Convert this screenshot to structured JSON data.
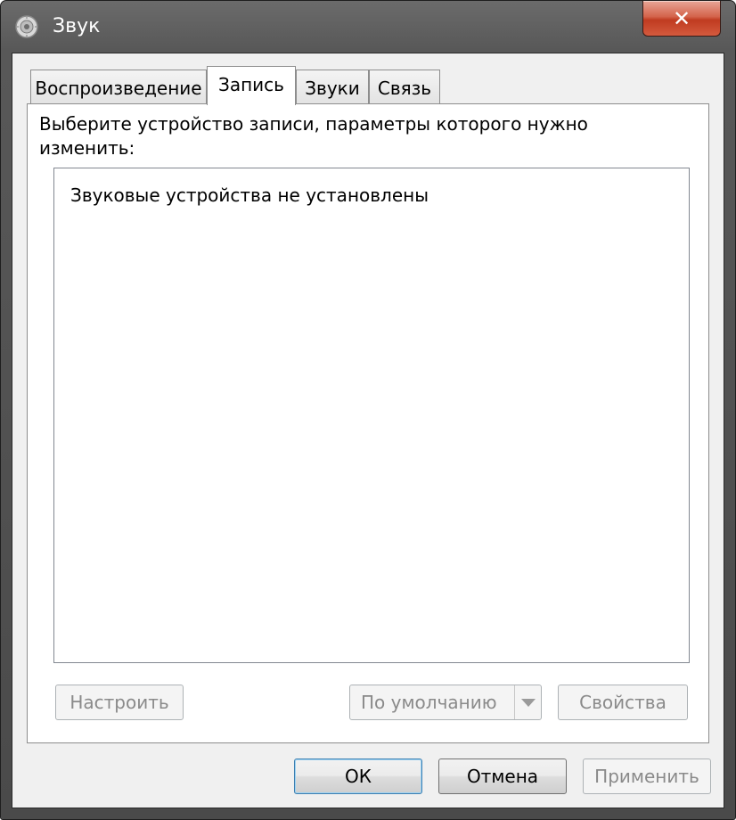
{
  "window": {
    "title": "Звук",
    "close_label": "✕"
  },
  "tabs": [
    {
      "label": "Воспроизведение",
      "active": false
    },
    {
      "label": "Запись",
      "active": true
    },
    {
      "label": "Звуки",
      "active": false
    },
    {
      "label": "Связь",
      "active": false
    }
  ],
  "recording": {
    "instructions": "Выберите устройство записи, параметры которого нужно изменить:",
    "empty_message": "Звуковые устройства не установлены",
    "configure_label": "Настроить",
    "default_label": "По умолчанию",
    "properties_label": "Свойства"
  },
  "footer": {
    "ok_label": "ОК",
    "cancel_label": "Отмена",
    "apply_label": "Применить"
  },
  "colors": {
    "frame": "#585858",
    "close_button": "#c03b20",
    "dialog_background": "#f0f0f0",
    "focus_border": "#3c7fb1"
  }
}
